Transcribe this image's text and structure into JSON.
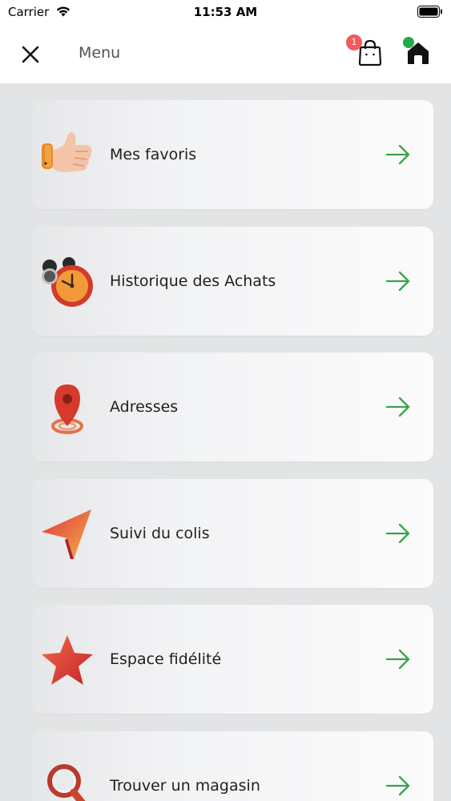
{
  "status_bar": {
    "carrier": "Carrier",
    "time": "11:53 AM"
  },
  "header": {
    "title": "Menu",
    "cart_badge": "1"
  },
  "colors": {
    "accent_green": "#23a84a",
    "badge_red": "#f25b5b"
  },
  "menu": {
    "items": [
      {
        "label": "Mes favoris",
        "icon": "thumbs-up-icon"
      },
      {
        "label": "Historique des Achats",
        "icon": "alarm-clock-icon"
      },
      {
        "label": "Adresses",
        "icon": "location-pin-icon"
      },
      {
        "label": "Suivi du colis",
        "icon": "navigation-arrow-icon"
      },
      {
        "label": "Espace fidélité",
        "icon": "star-icon"
      },
      {
        "label": "Trouver un magasin",
        "icon": "magnifier-icon"
      }
    ]
  }
}
